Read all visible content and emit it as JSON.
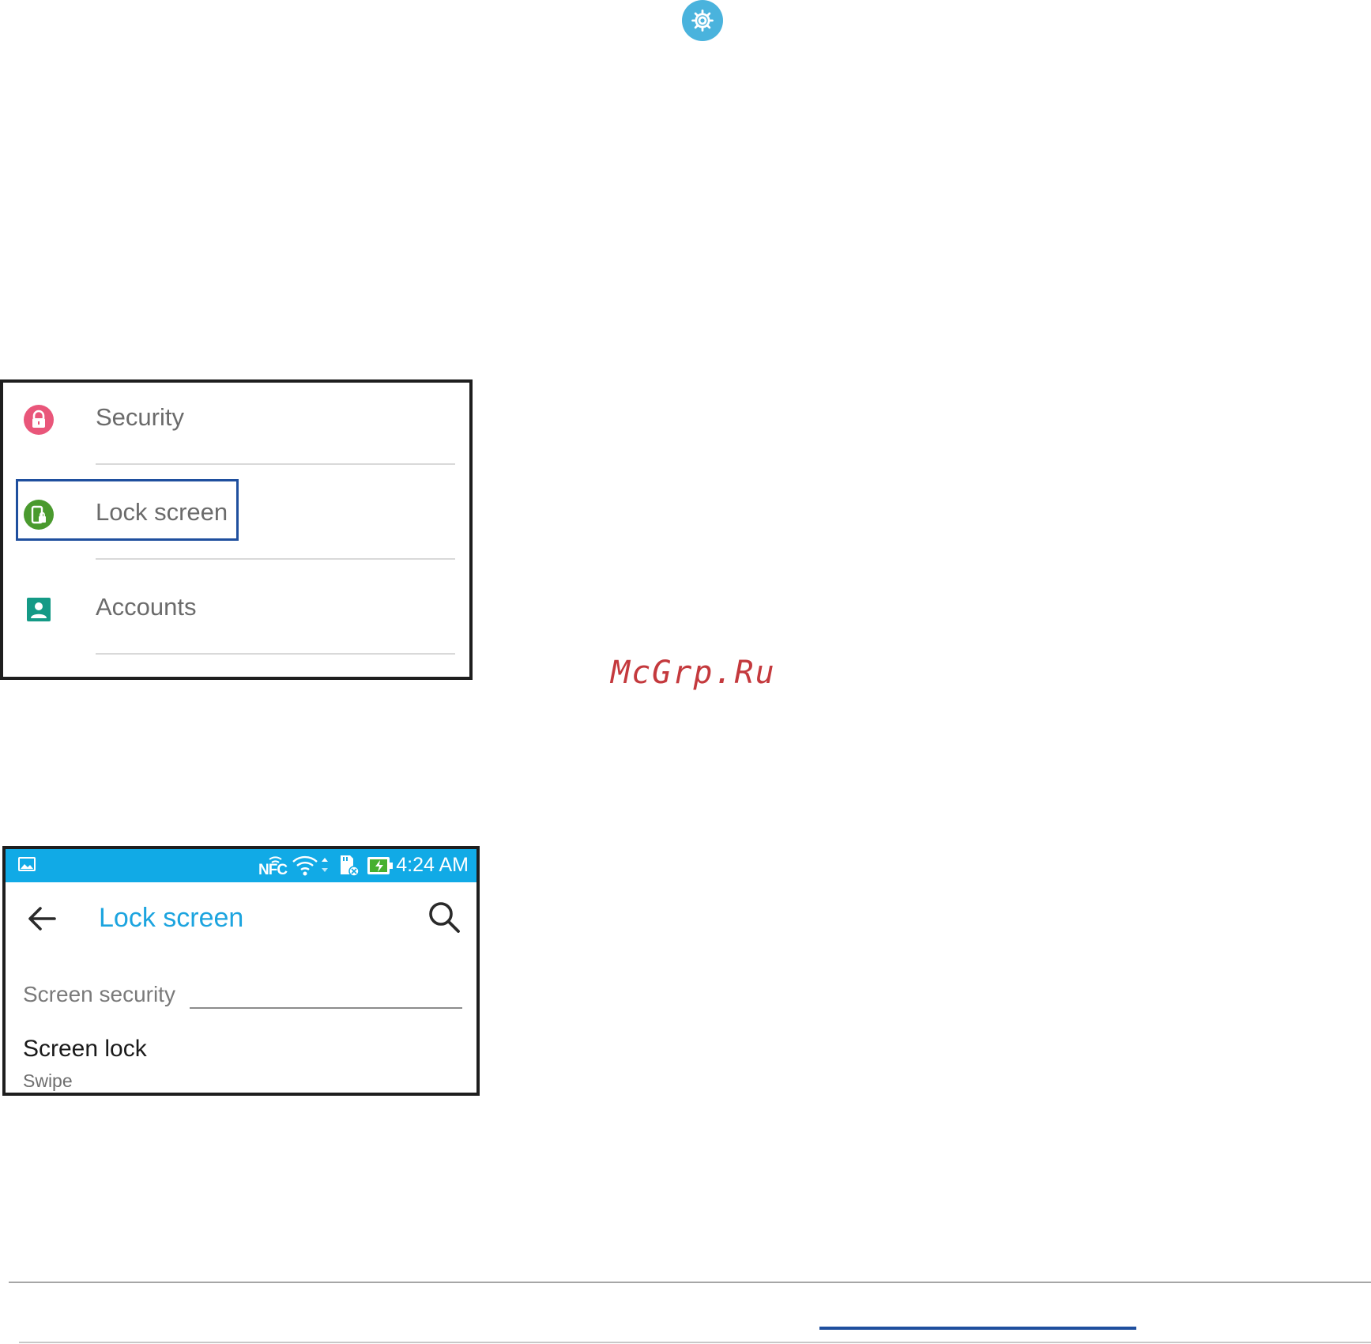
{
  "icons": {
    "gear": "gear-icon",
    "security": "lock-icon",
    "lock_screen": "phone-lock-icon",
    "accounts": "account-icon",
    "gallery": "image-icon",
    "nfc": "nfc-icon",
    "wifi": "wifi-icon",
    "sd": "sd-card-icon",
    "battery": "battery-charging-icon",
    "back": "back-arrow-icon",
    "search": "search-icon"
  },
  "colors": {
    "gear_bg": "#4ab3dd",
    "security_icon": "#e9567a",
    "lock_screen_icon": "#4a9a2e",
    "accounts_icon": "#149a86",
    "highlight_border": "#1f4f9e",
    "status_bar": "#11aae6",
    "accent_title": "#1ca4df",
    "watermark": "#c4393d"
  },
  "settings_list": {
    "items": [
      {
        "label": "Security"
      },
      {
        "label": "Lock screen",
        "highlighted": true
      },
      {
        "label": "Accounts"
      }
    ]
  },
  "watermark": "McGrp.Ru",
  "lock_screen": {
    "status": {
      "nfc_label": "NFC",
      "time": "4:24 AM"
    },
    "title": "Lock screen",
    "section_header": "Screen security",
    "items": [
      {
        "title": "Screen lock",
        "subtitle": "Swipe"
      }
    ]
  }
}
